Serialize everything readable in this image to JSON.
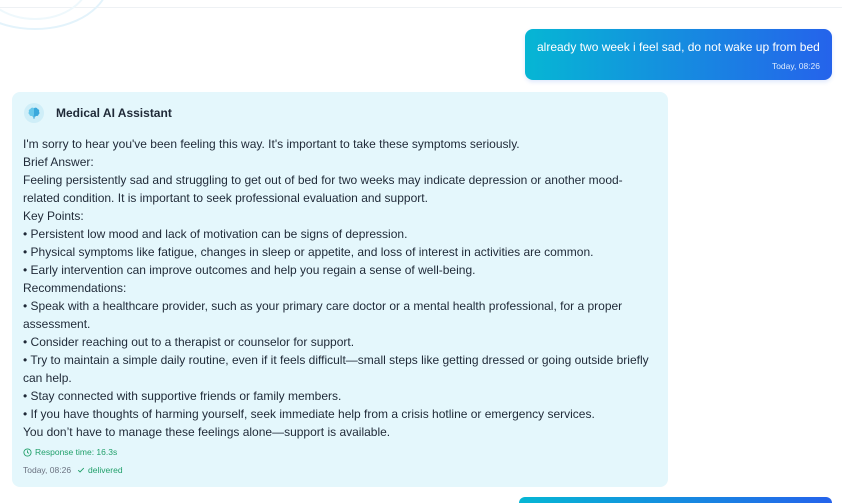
{
  "colors": {
    "user_gradient_start": "#06b6d4",
    "user_gradient_end": "#2563eb",
    "assistant_bubble": "#e4f7fc",
    "status_green": "#22a06b"
  },
  "messages": {
    "user": {
      "text": "already two week i feel sad, do not wake up from bed",
      "time": "Today, 08:26"
    },
    "assistant": {
      "avatar_icon": "brain-icon",
      "name": "Medical AI Assistant",
      "lines": [
        "I'm sorry to hear you've been feeling this way. It's important to take these symptoms seriously.",
        "Brief Answer:",
        "Feeling persistently sad and struggling to get out of bed for two weeks may indicate depression or another mood-",
        "related condition. It is important to seek professional evaluation and support.",
        "Key Points:",
        "• Persistent low mood and lack of motivation can be signs of depression.",
        "• Physical symptoms like fatigue, changes in sleep or appetite, and loss of interest in activities are common.",
        "• Early intervention can improve outcomes and help you regain a sense of well-being.",
        "Recommendations:",
        "• Speak with a healthcare provider, such as your primary care doctor or a mental health professional, for a proper",
        "assessment.",
        "• Consider reaching out to a therapist or counselor for support.",
        "• Try to maintain a simple daily routine, even if it feels difficult—small steps like getting dressed or going outside briefly",
        "can help.",
        "• Stay connected with supportive friends or family members.",
        "• If you have thoughts of harming yourself, seek immediate help from a crisis hotline or emergency services.",
        "You don’t have to manage these feelings alone—support is available."
      ],
      "response_time": "Response time: 16.3s",
      "time": "Today, 08:26",
      "status": "delivered"
    }
  }
}
